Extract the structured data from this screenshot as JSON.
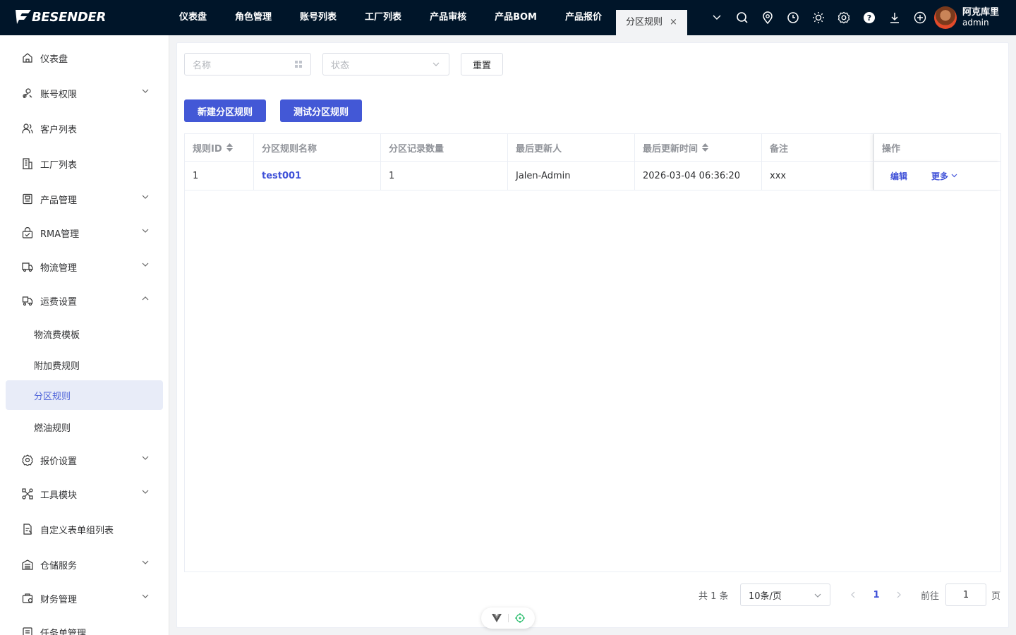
{
  "app": {
    "logo_text": "BESENDER"
  },
  "topnav": {
    "items": [
      "仪表盘",
      "角色管理",
      "账号列表",
      "工厂列表",
      "产品审核",
      "产品BOM",
      "产品报价"
    ],
    "active_tab": "分区规则",
    "close_glyph": "×"
  },
  "header_icons": [
    "chevron-down-icon",
    "search-icon",
    "location-icon",
    "clock-icon",
    "sun-icon",
    "gear-icon",
    "help-icon",
    "download-icon",
    "plus-circle-icon"
  ],
  "user": {
    "name": "阿克库里",
    "role": "admin"
  },
  "sidebar": {
    "items": [
      {
        "label": "仪表盘",
        "icon": "home-icon"
      },
      {
        "label": "账号权限",
        "icon": "user-key-icon"
      },
      {
        "label": "客户列表",
        "icon": "users-icon"
      },
      {
        "label": "工厂列表",
        "icon": "building-icon"
      },
      {
        "label": "产品管理",
        "icon": "product-icon"
      },
      {
        "label": "RMA管理",
        "icon": "rma-icon"
      },
      {
        "label": "物流管理",
        "icon": "truck-icon"
      },
      {
        "label": "运费设置",
        "icon": "freight-icon"
      },
      {
        "label": "物流费模板"
      },
      {
        "label": "附加费规则"
      },
      {
        "label": "分区规则"
      },
      {
        "label": "燃油规则"
      },
      {
        "label": "报价设置",
        "icon": "settings-icon"
      },
      {
        "label": "工具模块",
        "icon": "tools-icon"
      },
      {
        "label": "自定义表单组列表",
        "icon": "form-icon"
      },
      {
        "label": "仓储服务",
        "icon": "warehouse-icon"
      },
      {
        "label": "财务管理",
        "icon": "finance-icon"
      },
      {
        "label": "任务单管理",
        "icon": "task-icon"
      }
    ],
    "selected": "分区规则"
  },
  "filters": {
    "name_placeholder": "名称",
    "status_placeholder": "状态",
    "reset_label": "重置"
  },
  "actions": {
    "new_label": "新建分区规则",
    "test_label": "测试分区规则"
  },
  "table": {
    "columns": [
      "规则ID",
      "分区规则名称",
      "分区记录数量",
      "最后更新人",
      "最后更新时间",
      "备注",
      "操作"
    ],
    "rows": [
      {
        "id": "1",
        "name": "test001",
        "count": "1",
        "updater": "Jalen-Admin",
        "updated_at": "2026-03-04 06:36:20",
        "remark": "xxx",
        "edit": "编辑",
        "more": "更多"
      }
    ]
  },
  "pagination": {
    "total": "共 1 条",
    "page_size": "10条/页",
    "current": "1",
    "goto_label": "前往",
    "goto_value": "1",
    "page_suffix": "页"
  },
  "colors": {
    "header_bg": "#001529",
    "primary": "#4358d6",
    "link": "#3f51d8",
    "selected_bg": "#e8ecf8"
  }
}
